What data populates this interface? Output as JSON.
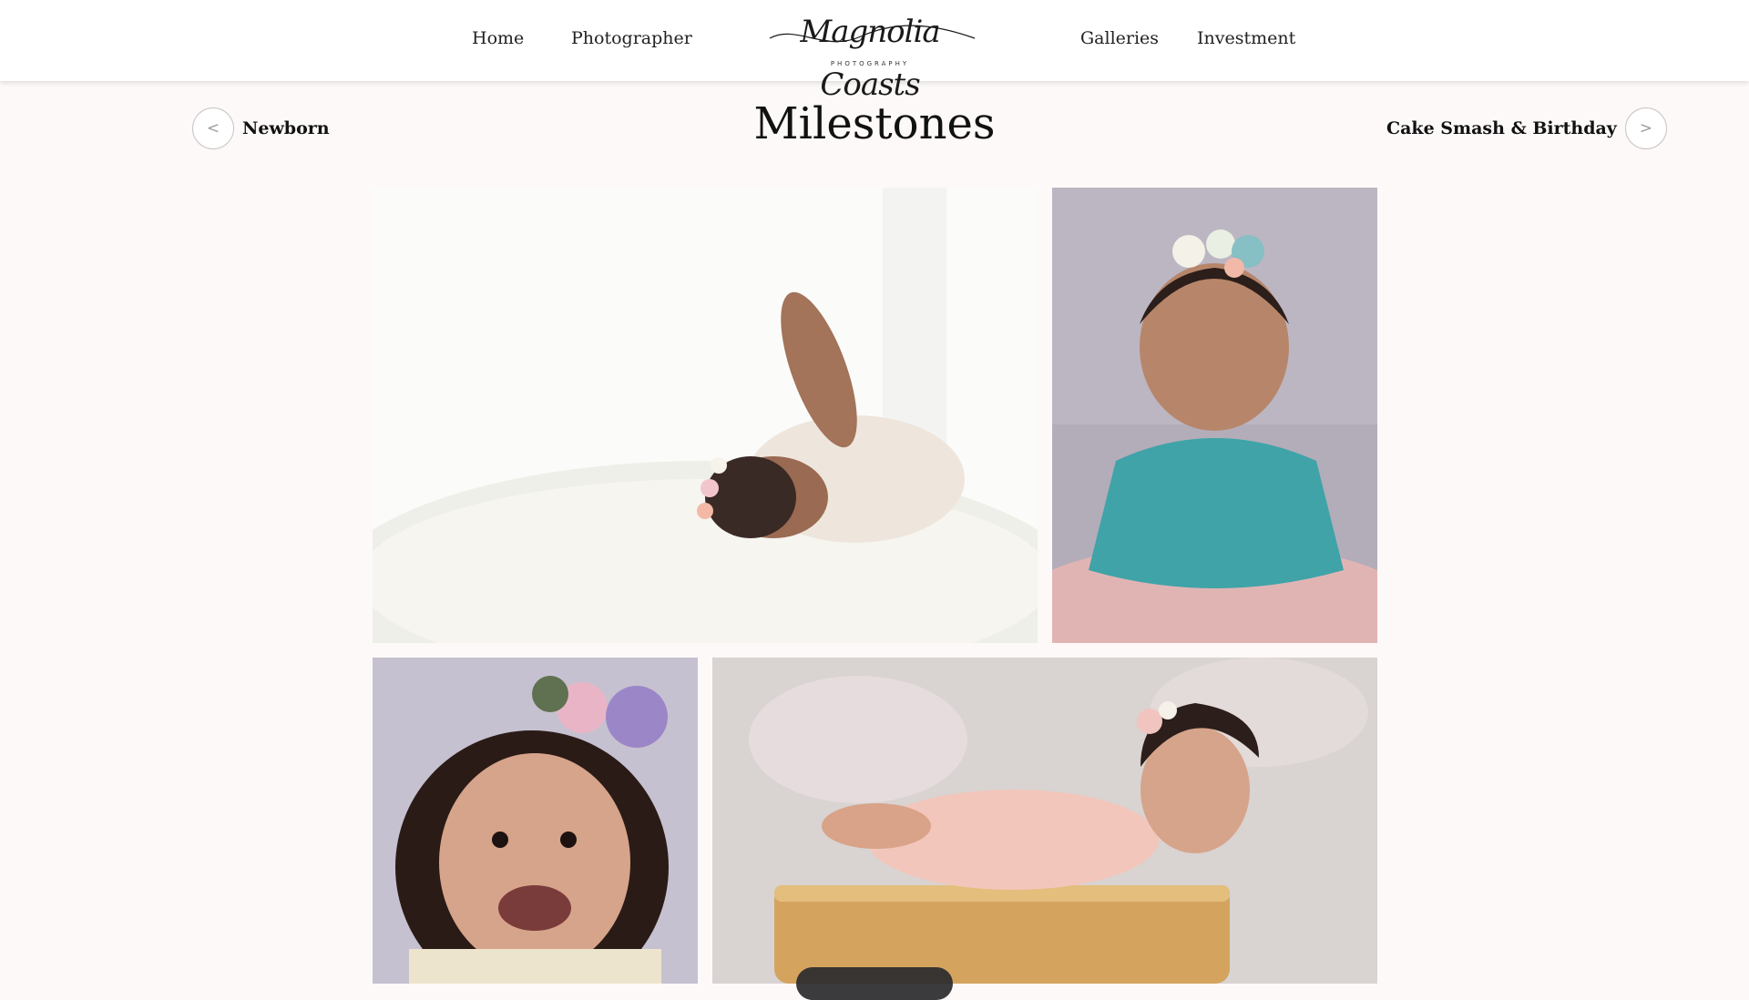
{
  "header": {
    "nav_left": [
      "Home",
      "Photographer"
    ],
    "nav_right": [
      "Galleries",
      "Investment"
    ],
    "logo": {
      "script": "Magnolia Coasts",
      "subtitle": "PHOTOGRAPHY"
    }
  },
  "subnav": {
    "prev": {
      "arrow": "<",
      "label": "Newborn"
    },
    "next": {
      "arrow": ">",
      "label": "Cake Smash & Birthday"
    }
  },
  "page": {
    "title": "Milestones"
  },
  "gallery": {
    "photos": [
      {
        "subject": "baby lying on white fur with floral headband"
      },
      {
        "subject": "baby in teal dress on pink fur with floral headband"
      },
      {
        "subject": "laughing baby with purple floral crown"
      },
      {
        "subject": "baby in pink dress lying on vintage suitcase"
      }
    ]
  },
  "colors": {
    "page_background": "#fdf9f8",
    "header_background": "#ffffff",
    "circle_border": "#c9c3c1"
  }
}
